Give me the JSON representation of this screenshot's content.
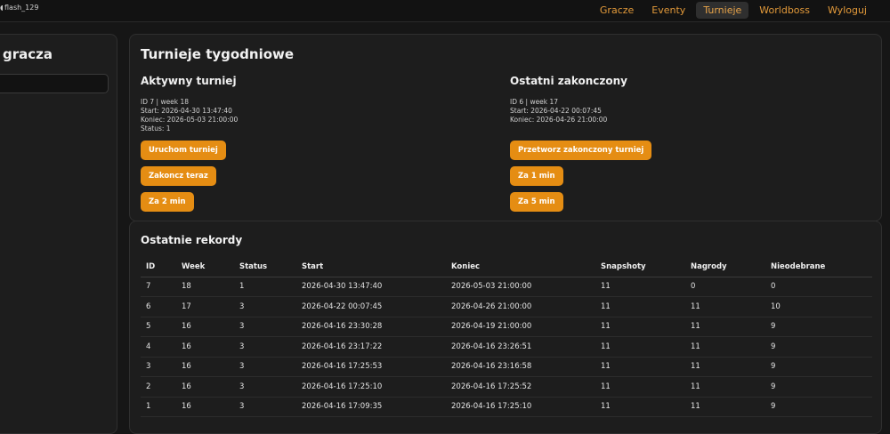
{
  "header": {
    "username": "flash_129",
    "nav": [
      {
        "label": "Gracze",
        "active": false
      },
      {
        "label": "Eventy",
        "active": false
      },
      {
        "label": "Turnieje",
        "active": true
      },
      {
        "label": "Worldboss",
        "active": false
      },
      {
        "label": "Wyloguj",
        "active": false
      }
    ]
  },
  "left_panel": {
    "title": "gracza",
    "search_value": ""
  },
  "tournaments": {
    "title": "Turnieje tygodniowe",
    "active": {
      "title": "Aktywny turniej",
      "info": [
        "ID 7 | week 18",
        "Start: 2026-04-30 13:47:40",
        "Koniec: 2026-05-03 21:00:00",
        "Status: 1"
      ],
      "buttons": [
        "Uruchom turniej",
        "Zakoncz teraz",
        "Za 2 min"
      ]
    },
    "last": {
      "title": "Ostatni zakonczony",
      "info": [
        "ID 6 | week 17",
        "Start: 2026-04-22 00:07:45",
        "Koniec: 2026-04-26 21:00:00"
      ],
      "buttons": [
        "Przetworz zakonczony turniej",
        "Za 1 min",
        "Za 5 min"
      ]
    }
  },
  "records": {
    "title": "Ostatnie rekordy",
    "columns": [
      "ID",
      "Week",
      "Status",
      "Start",
      "Koniec",
      "Snapshoty",
      "Nagrody",
      "Nieodebrane"
    ],
    "rows": [
      [
        "7",
        "18",
        "1",
        "2026-04-30 13:47:40",
        "2026-05-03 21:00:00",
        "11",
        "0",
        "0"
      ],
      [
        "6",
        "17",
        "3",
        "2026-04-22 00:07:45",
        "2026-04-26 21:00:00",
        "11",
        "11",
        "10"
      ],
      [
        "5",
        "16",
        "3",
        "2026-04-16 23:30:28",
        "2026-04-19 21:00:00",
        "11",
        "11",
        "9"
      ],
      [
        "4",
        "16",
        "3",
        "2026-04-16 23:17:22",
        "2026-04-16 23:26:51",
        "11",
        "11",
        "9"
      ],
      [
        "3",
        "16",
        "3",
        "2026-04-16 17:25:53",
        "2026-04-16 23:16:58",
        "11",
        "11",
        "9"
      ],
      [
        "2",
        "16",
        "3",
        "2026-04-16 17:25:10",
        "2026-04-16 17:25:52",
        "11",
        "11",
        "9"
      ],
      [
        "1",
        "16",
        "3",
        "2026-04-16 17:09:35",
        "2026-04-16 17:25:10",
        "11",
        "11",
        "9"
      ]
    ]
  },
  "colors": {
    "accent": "#e58d13",
    "nav_text": "#e39a3a",
    "background": "#161616",
    "card": "#1d1d1d"
  }
}
